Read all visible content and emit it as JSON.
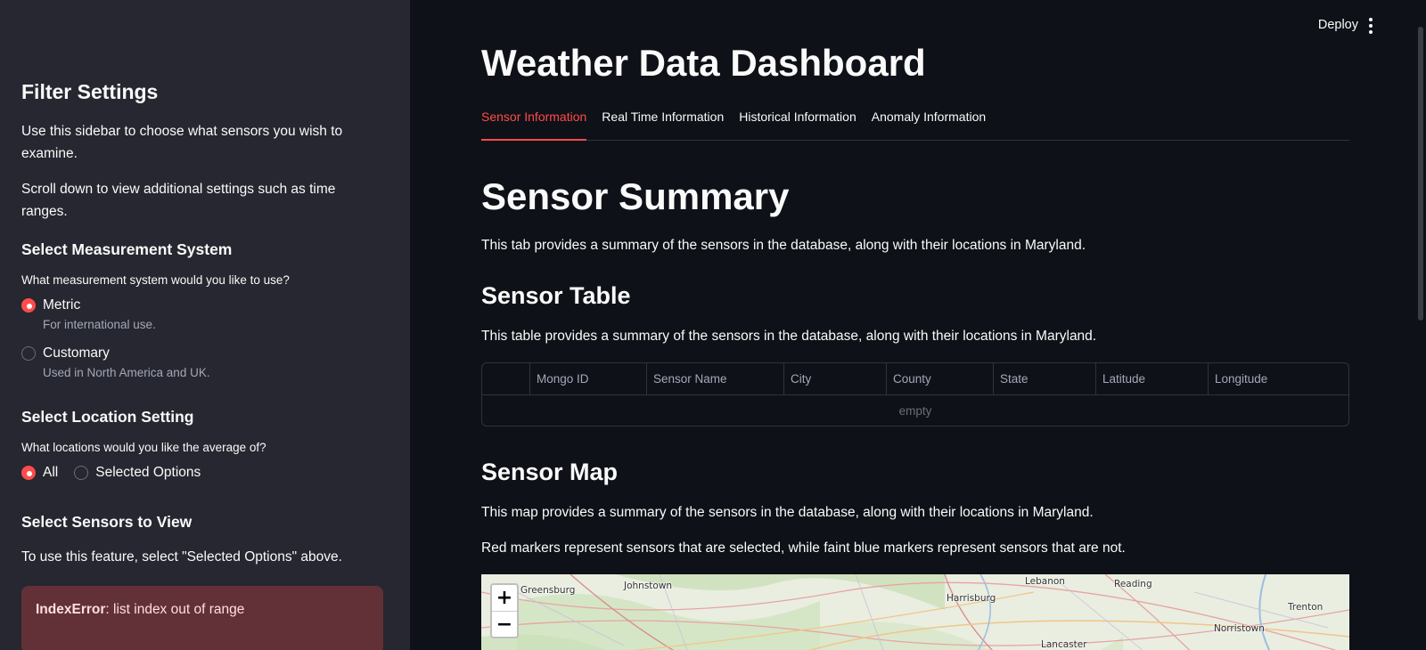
{
  "header": {
    "deploy_label": "Deploy",
    "menu_icon": "kebab-menu-icon"
  },
  "sidebar": {
    "title": "Filter Settings",
    "intro": "Use this sidebar to choose what sensors you wish to examine.",
    "scroll_note": "Scroll down to view additional settings such as time ranges.",
    "measurement": {
      "heading": "Select Measurement System",
      "question": "What measurement system would you like to use?",
      "options": [
        {
          "label": "Metric",
          "caption": "For international use.",
          "selected": true
        },
        {
          "label": "Customary",
          "caption": "Used in North America and UK.",
          "selected": false
        }
      ]
    },
    "location": {
      "heading": "Select Location Setting",
      "question": "What locations would you like the average of?",
      "options": [
        {
          "label": "All",
          "selected": true
        },
        {
          "label": "Selected Options",
          "selected": false
        }
      ]
    },
    "sensors": {
      "heading": "Select Sensors to View",
      "note": "To use this feature, select \"Selected Options\" above."
    },
    "error": {
      "type": "IndexError",
      "message": ": list index out of range"
    }
  },
  "main": {
    "title": "Weather Data Dashboard",
    "tabs": [
      {
        "label": "Sensor Information",
        "active": true
      },
      {
        "label": "Real Time Information",
        "active": false
      },
      {
        "label": "Historical Information",
        "active": false
      },
      {
        "label": "Anomaly Information",
        "active": false
      }
    ],
    "summary_heading": "Sensor Summary",
    "summary_text": "This tab provides a summary of the sensors in the database, along with their locations in Maryland.",
    "table_heading": "Sensor Table",
    "table_text": "This table provides a summary of the sensors in the database, along with their locations in Maryland.",
    "table": {
      "columns": [
        "",
        "Mongo ID",
        "Sensor Name",
        "City",
        "County",
        "State",
        "Latitude",
        "Longitude"
      ],
      "empty_text": "empty"
    },
    "map_heading": "Sensor Map",
    "map_text": "This map provides a summary of the sensors in the database, along with their locations in Maryland.",
    "map_legend_text": "Red markers represent sensors that are selected, while faint blue markers represent sensors that are not.",
    "map": {
      "zoom_in": "+",
      "zoom_out": "−",
      "places": [
        "Greensburg",
        "Johnstown",
        "Harrisburg",
        "Lebanon",
        "Reading",
        "Trenton",
        "Norristown",
        "Lancaster"
      ]
    }
  },
  "colors": {
    "accent": "#ff4b4b",
    "background": "#0e1117",
    "sidebar": "#262730"
  }
}
